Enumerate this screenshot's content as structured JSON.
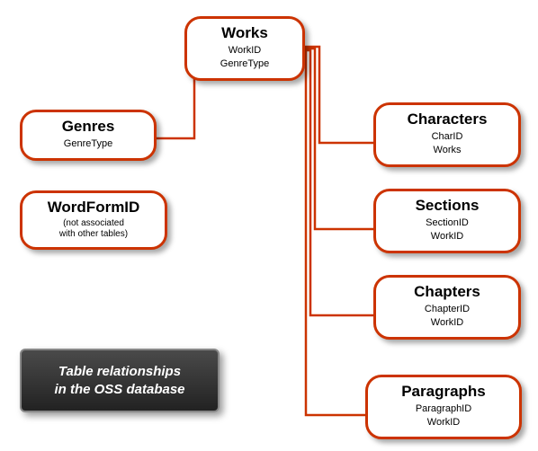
{
  "tables": {
    "works": {
      "title": "Works",
      "fields": [
        "WorkID",
        "GenreType"
      ]
    },
    "genres": {
      "title": "Genres",
      "fields": [
        "GenreType"
      ]
    },
    "wordform": {
      "title": "WordFormID",
      "note1": "(not associated",
      "note2": "with other tables)"
    },
    "characters": {
      "title": "Characters",
      "fields": [
        "CharID",
        "Works"
      ]
    },
    "sections": {
      "title": "Sections",
      "fields": [
        "SectionID",
        "WorkID"
      ]
    },
    "chapters": {
      "title": "Chapters",
      "fields": [
        "ChapterID",
        "WorkID"
      ]
    },
    "paragraphs": {
      "title": "Paragraphs",
      "fields": [
        "ParagraphID",
        "WorkID"
      ]
    }
  },
  "caption": {
    "line1": "Table relationships",
    "line2": "in the OSS database"
  },
  "colors": {
    "stroke": "#cc3300",
    "shadow": "rgba(0,0,0,0.35)"
  },
  "relationships": [
    {
      "from": "Genres.GenreType",
      "to": "Works.GenreType"
    },
    {
      "from": "Characters.Works",
      "to": "Works.WorkID"
    },
    {
      "from": "Sections.WorkID",
      "to": "Works.WorkID"
    },
    {
      "from": "Chapters.WorkID",
      "to": "Works.WorkID"
    },
    {
      "from": "Paragraphs.WorkID",
      "to": "Works.WorkID"
    }
  ]
}
